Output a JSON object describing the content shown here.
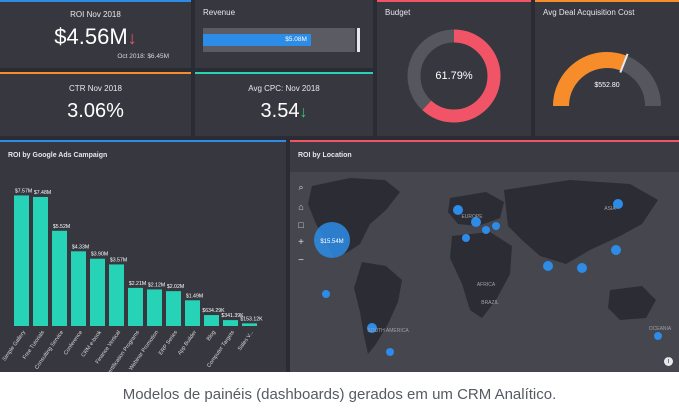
{
  "colors": {
    "background": "#2b2c33",
    "tile": "#36373f",
    "teal": "#27d3b7",
    "blue": "#2d8ce8",
    "red": "#f05466",
    "orange": "#f78d2a",
    "green": "#37c96a"
  },
  "roi": {
    "title": "ROI Nov 2018",
    "value": "$4.56M",
    "trend_icon": "arrow-down-icon",
    "subtext": "Oct 2018: $6.45M"
  },
  "revenue": {
    "title": "Revenue",
    "bar_label": "$5.08M",
    "fill_fraction": 0.71
  },
  "budget": {
    "title": "Budget",
    "value": "61.79%",
    "fraction": 0.6179
  },
  "deal_cost": {
    "title": "Avg Deal Acquisition Cost",
    "value": "$552.80",
    "fraction": 0.62
  },
  "ctr": {
    "title": "CTR Nov 2018",
    "value": "3.06%"
  },
  "cpc": {
    "title": "Avg CPC: Nov 2018",
    "value": "3.54",
    "trend_icon": "arrow-down-icon"
  },
  "campaign": {
    "title": "ROI by Google Ads Campaign"
  },
  "chart_data": {
    "type": "bar",
    "title": "ROI by Google Ads Campaign",
    "categories": [
      "Simple Gallery",
      "Free Tutorials",
      "Consulting Service",
      "Conference",
      "CRM e-book",
      "Finance Vertical",
      "Certification Programs",
      "Webinar Promotion",
      "ERP Series",
      "App Builder",
      "Blog",
      "Computer Targets",
      "Sales V..."
    ],
    "values": [
      7.57,
      7.48,
      5.52,
      4.33,
      3.9,
      3.57,
      2.21,
      2.12,
      2.02,
      1.49,
      0.634,
      0.341,
      0.153
    ],
    "data_labels": [
      "$7.57M",
      "$7.48M",
      "$5.52M",
      "$4.33M",
      "$3.90M",
      "$3.57M",
      "$2.21M",
      "$2.12M",
      "$2.02M",
      "$1.49M",
      "$634.29K",
      "$341.39K",
      "$153.12K"
    ],
    "ylim": [
      0,
      8
    ],
    "color": "#27d3b7"
  },
  "location": {
    "title": "ROI by Location",
    "bubble_label": "$15.54M",
    "map_labels": [
      "EUROPE",
      "ASIA",
      "AFRICA",
      "BRAZIL",
      "SOUTH AMERICA",
      "OCEANIA"
    ],
    "tools": [
      "search-icon",
      "home-icon",
      "zoom-in-icon",
      "crop-icon",
      "zoom-out-icon"
    ]
  },
  "caption": "Modelos de painéis (dashboards) gerados em um CRM Analítico."
}
